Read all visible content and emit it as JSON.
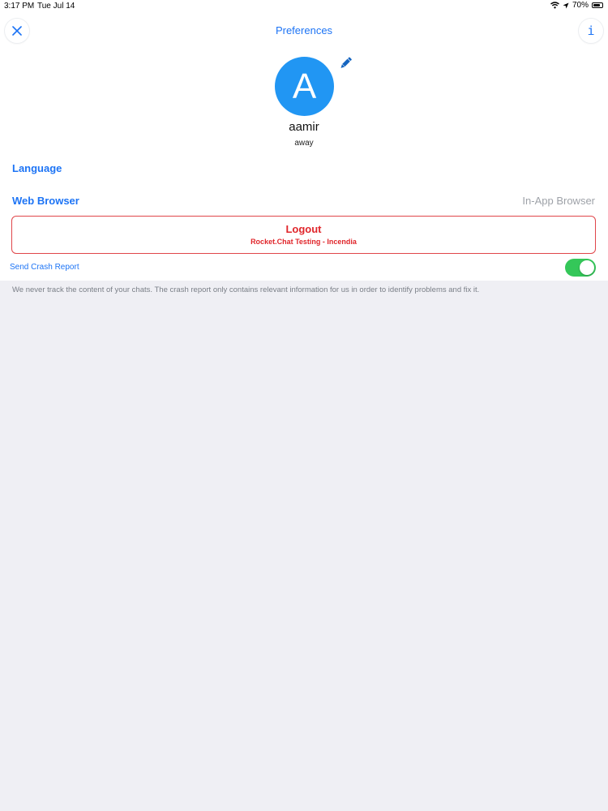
{
  "status_bar": {
    "time": "3:17 PM",
    "date": "Tue Jul 14",
    "battery": "70%"
  },
  "header": {
    "title": "Preferences",
    "close_icon": "close-icon",
    "info_icon": "info-icon",
    "info_glyph": "i"
  },
  "profile": {
    "avatar_letter": "A",
    "avatar_color": "#2196f3",
    "username": "aamir",
    "status": "away"
  },
  "settings": {
    "language_label": "Language",
    "web_browser_label": "Web Browser",
    "web_browser_value": "In-App Browser"
  },
  "logout": {
    "label": "Logout",
    "server": "Rocket.Chat Testing - Incendia"
  },
  "crash_report": {
    "label": "Send Crash Report",
    "enabled": true,
    "info": "We never track the content of your chats. The crash report only contains relevant information for us in order to identify problems and fix it."
  },
  "colors": {
    "accent": "#1d74f5",
    "danger": "#e0262b",
    "toggle_on": "#34c759"
  }
}
